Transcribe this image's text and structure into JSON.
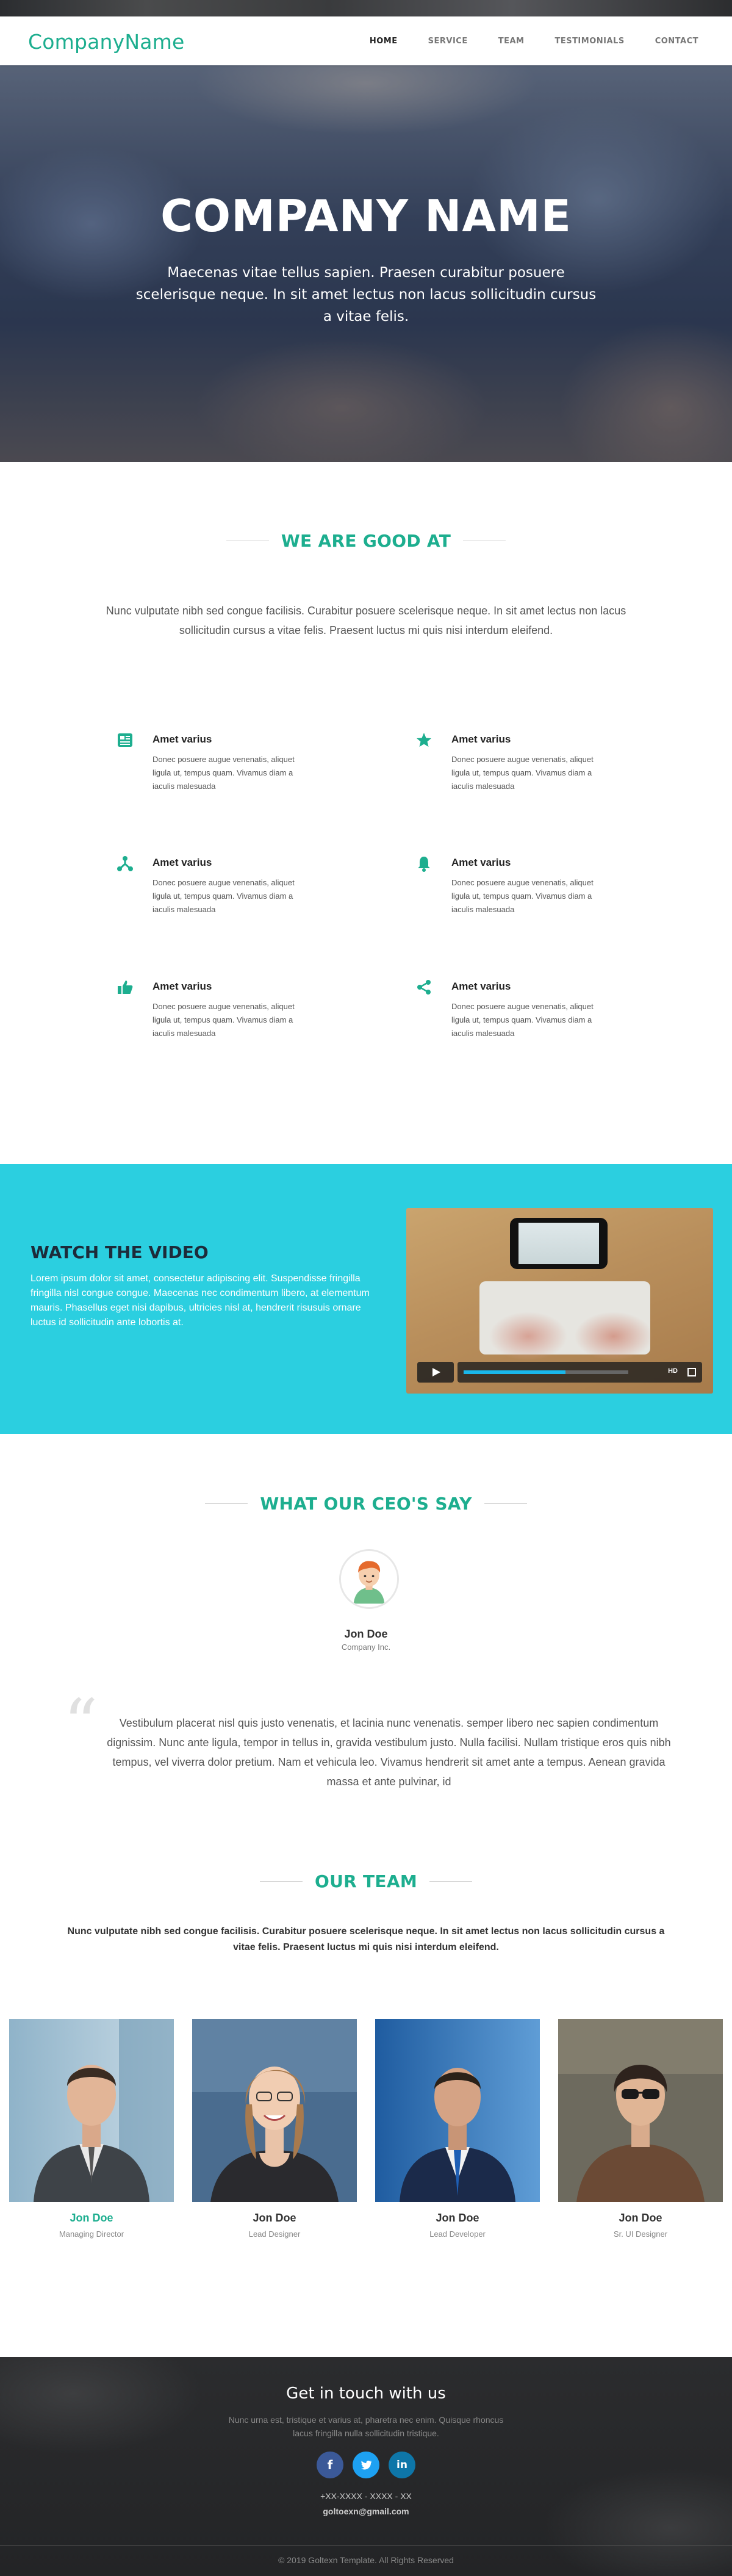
{
  "brand": "CompanyName",
  "nav": {
    "home": "HOME",
    "service": "SERVICE",
    "team": "TEAM",
    "testimonials": "TESTIMONIALS",
    "contact": "CONTACT"
  },
  "hero": {
    "title": "COMPANY NAME",
    "subtitle": "Maecenas vitae tellus sapien. Praesen curabitur posuere scelerisque neque. In sit amet lectus non lacus sollicitudin cursus a vitae felis."
  },
  "good_at": {
    "heading": "WE ARE GOOD AT",
    "intro": "Nunc vulputate nibh sed congue facilisis. Curabitur posuere scelerisque neque. In sit amet lectus non lacus sollicitudin cursus a vitae felis. Praesent luctus mi quis nisi interdum eleifend.",
    "features": [
      {
        "icon": "gallery-icon",
        "title": "Amet varius",
        "text": "Donec posuere augue venenatis, aliquet ligula ut, tempus quam. Vivamus diam a iaculis malesuada"
      },
      {
        "icon": "star-icon",
        "title": "Amet varius",
        "text": "Donec posuere augue venenatis, aliquet ligula ut, tempus quam. Vivamus diam a iaculis malesuada"
      },
      {
        "icon": "network-icon",
        "title": "Amet varius",
        "text": "Donec posuere augue venenatis, aliquet ligula ut, tempus quam. Vivamus diam a iaculis malesuada"
      },
      {
        "icon": "bell-icon",
        "title": "Amet varius",
        "text": "Donec posuere augue venenatis, aliquet ligula ut, tempus quam. Vivamus diam a iaculis malesuada"
      },
      {
        "icon": "thumbs-up-icon",
        "title": "Amet varius",
        "text": "Donec posuere augue venenatis, aliquet ligula ut, tempus quam. Vivamus diam a iaculis malesuada"
      },
      {
        "icon": "share-icon",
        "title": "Amet varius",
        "text": "Donec posuere augue venenatis, aliquet ligula ut, tempus quam. Vivamus diam a iaculis malesuada"
      }
    ]
  },
  "video": {
    "title": "WATCH THE VIDEO",
    "text": "Lorem ipsum dolor sit amet, consectetur adipiscing elit. Suspendisse fringilla fringilla nisl congue congue. Maecenas nec condimentum libero, at elementum mauris. Phasellus eget nisi dapibus, ultricies nisl at, hendrerit risusuis ornare luctus id sollicitudin ante lobortis at.",
    "progress": 0.62,
    "hd_label": "HD"
  },
  "testimonials": {
    "heading": "WHAT OUR CEO'S SAY",
    "name": "Jon Doe",
    "role": "Company Inc.",
    "quote": "Vestibulum placerat nisl quis justo venenatis, et lacinia nunc venenatis. semper libero nec sapien condimentum dignissim. Nunc ante ligula, tempor in tellus in, gravida vestibulum justo. Nulla facilisi. Nullam tristique eros quis nibh tempus, vel viverra dolor pretium. Nam et vehicula leo. Vivamus hendrerit sit amet ante a tempus. Aenean gravida massa et ante pulvinar, id"
  },
  "team": {
    "heading": "OUR TEAM",
    "intro": "Nunc vulputate nibh sed congue facilisis. Curabitur posuere scelerisque neque. In sit amet lectus non lacus sollicitudin cursus a vitae felis. Praesent luctus mi quis nisi interdum eleifend.",
    "members": [
      {
        "name": "Jon Doe",
        "role": "Managing Director",
        "highlight": true
      },
      {
        "name": "Jon Doe",
        "role": "Lead Designer",
        "highlight": false
      },
      {
        "name": "Jon Doe",
        "role": "Lead Developer",
        "highlight": false
      },
      {
        "name": "Jon Doe",
        "role": "Sr. UI Designer",
        "highlight": false
      }
    ]
  },
  "footer": {
    "title": "Get in touch with us",
    "text": "Nunc urna est, tristique et varius at, pharetra nec enim. Quisque rhoncus lacus fringilla nulla sollicitudin tristique.",
    "social": [
      "f",
      "t",
      "in"
    ],
    "phone": "+XX-XXXX - XXXX - XX",
    "email": "goltoexn@gmail.com",
    "copyright": "© 2019 Goltexn Template. All Rights Reserved"
  },
  "colors": {
    "accent": "#1dae8f",
    "video_bg": "#2bcfe0",
    "facebook": "#3b5998",
    "twitter": "#1da1f2",
    "linkedin": "#0e76a8"
  }
}
